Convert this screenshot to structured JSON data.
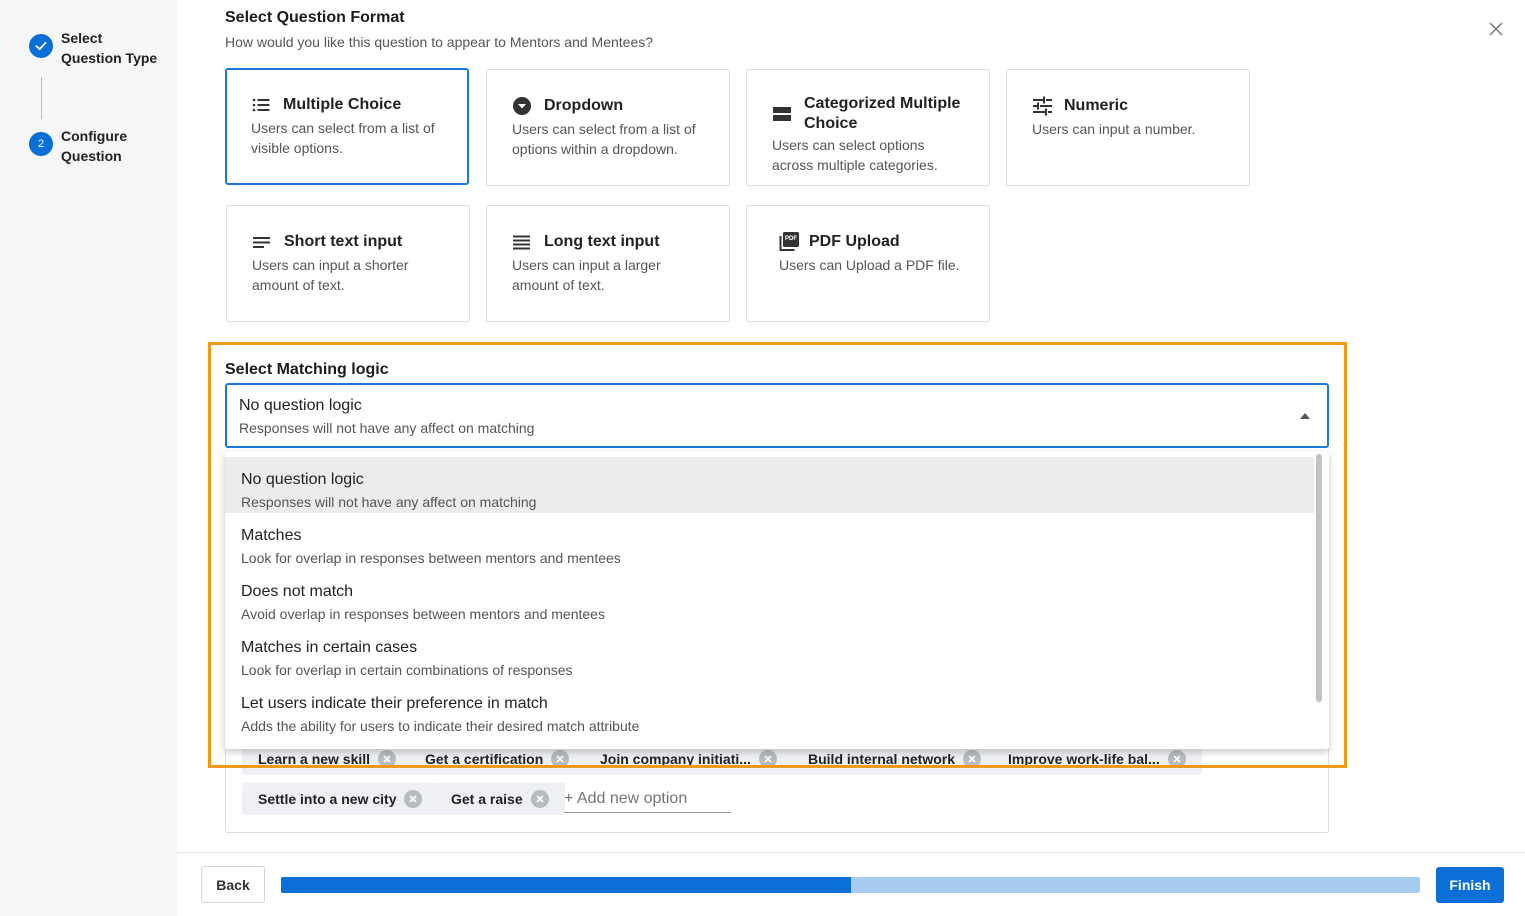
{
  "sidebar": {
    "steps": [
      {
        "label_line1": "Select",
        "label_line2": "Question Type",
        "state": "done"
      },
      {
        "number": "2",
        "label_line1": "Configure",
        "label_line2": "Question",
        "state": "current"
      }
    ]
  },
  "format": {
    "title": "Select Question Format",
    "subtitle": "How would you like this question to appear to Mentors and Mentees?",
    "cards": [
      {
        "icon": "list-icon",
        "title": "Multiple Choice",
        "desc": "Users can select from a list of visible options.",
        "selected": true
      },
      {
        "icon": "dropdown-circle-icon",
        "title": "Dropdown",
        "desc": "Users can select from a list of options within a dropdown."
      },
      {
        "icon": "categories-icon",
        "title": "Categorized Multiple Choice",
        "desc": "Users can select options across multiple categories."
      },
      {
        "icon": "sliders-icon",
        "title": "Numeric",
        "desc": "Users can input a number."
      },
      {
        "icon": "short-text-icon",
        "title": "Short text input",
        "desc": "Users can input a shorter amount of text."
      },
      {
        "icon": "long-text-icon",
        "title": "Long text input",
        "desc": "Users can input a larger amount of text."
      },
      {
        "icon": "pdf-icon",
        "pdf_badge": "PDF",
        "title": "PDF Upload",
        "desc": "Users can Upload a PDF file."
      }
    ]
  },
  "matching": {
    "title": "Select Matching logic",
    "selected_main": "No question logic",
    "selected_sub": "Responses will not have any affect on matching",
    "options": [
      {
        "main": "No question logic",
        "sub": "Responses will not have any affect on matching"
      },
      {
        "main": "Matches",
        "sub": "Look for overlap in responses between mentors and mentees"
      },
      {
        "main": "Does not match",
        "sub": "Avoid overlap in responses between mentors and mentees"
      },
      {
        "main": "Matches in certain cases",
        "sub": "Look for overlap in certain combinations of responses"
      },
      {
        "main": "Let users indicate their preference in match",
        "sub": "Adds the ability for users to indicate their desired match attribute"
      }
    ]
  },
  "answer_options": {
    "chips": [
      "Learn a new skill",
      "Get a certification",
      "Join company initiati...",
      "Build internal network",
      "Improve work-life bal...",
      "Settle into a new city",
      "Get a raise"
    ],
    "add_placeholder": "+ Add new option"
  },
  "footer": {
    "back_label": "Back",
    "finish_label": "Finish",
    "progress": 0.5
  },
  "colors": {
    "accent": "#0a6fd6",
    "highlight": "#f39a1d",
    "progress_track": "#a7ccef"
  }
}
